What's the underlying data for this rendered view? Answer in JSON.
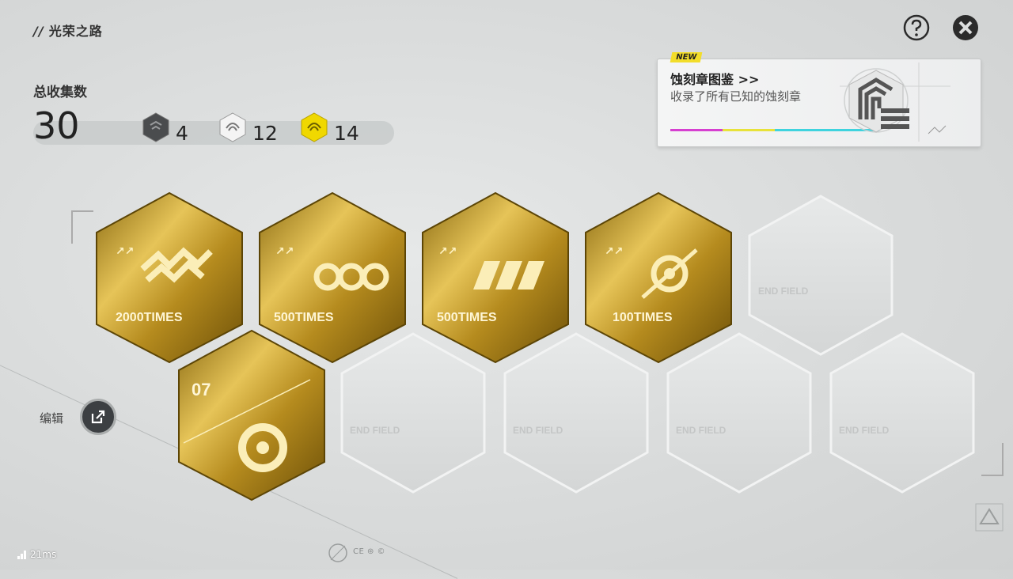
{
  "header": {
    "slash": "//",
    "title": "光荣之路"
  },
  "stats": {
    "total_label": "总收集数",
    "total_count": "30",
    "tiers": [
      {
        "name": "dark-tier",
        "count": "4",
        "color": "#4a4c4e"
      },
      {
        "name": "silver-tier",
        "count": "12",
        "color": "#eeeeee"
      },
      {
        "name": "gold-tier",
        "count": "14",
        "color": "#f0d800"
      }
    ]
  },
  "catalog": {
    "badge": "NEW",
    "title": "蚀刻章图鉴 >>",
    "subtitle": "收录了所有已知的蚀刻章",
    "stripe_colors": [
      "#d63fd0",
      "#e8e23a",
      "#3fd3de",
      "#cfd1d1"
    ]
  },
  "edit": {
    "label": "编辑"
  },
  "medals": [
    {
      "name": "medal-2000-times",
      "caption": "2000TIMES"
    },
    {
      "name": "medal-500-times-a",
      "caption": "500TIMES"
    },
    {
      "name": "medal-500-times-b",
      "caption": "500TIMES"
    },
    {
      "name": "medal-100-times",
      "caption": "100TIMES"
    },
    {
      "name": "medal-level-07",
      "caption": "07"
    }
  ],
  "empty_slot_logo": "END FIELD",
  "footer": {
    "latency": "21ms",
    "brand_marks": "CE ⊛ ©"
  },
  "colors": {
    "gold": "#c9a227",
    "background": "#dcdede",
    "dark_button": "#3c3f42"
  }
}
